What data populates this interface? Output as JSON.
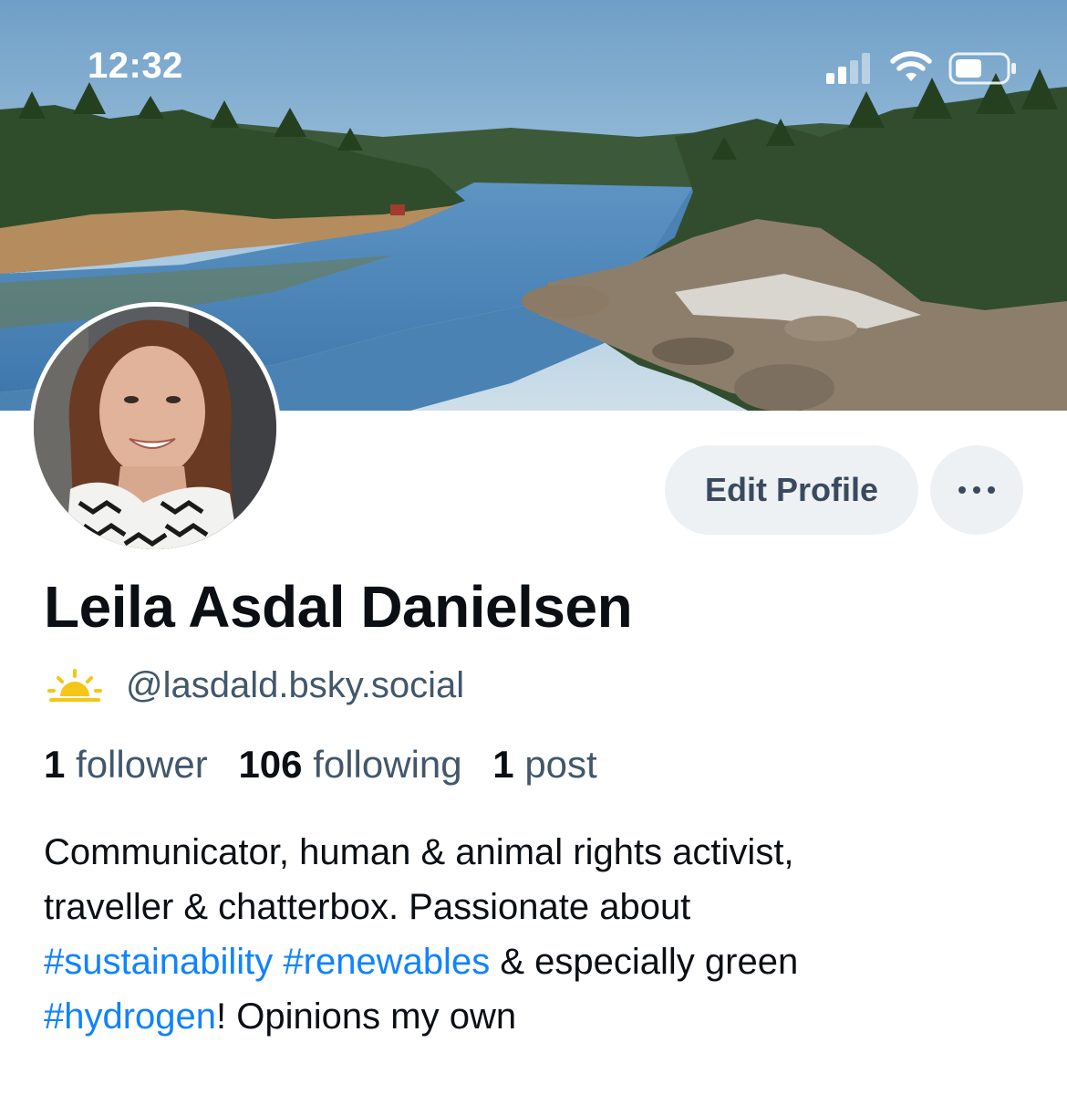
{
  "status_bar": {
    "time": "12:32"
  },
  "profile": {
    "display_name": "Leila Asdal Danielsen",
    "handle": "@lasdald.bsky.social",
    "handle_icon": "sunrise-icon",
    "edit_button": "Edit Profile",
    "more_icon": "ellipsis-icon"
  },
  "stats": {
    "followers_count": "1",
    "followers_label": "follower",
    "following_count": "106",
    "following_label": "following",
    "posts_count": "1",
    "posts_label": "post"
  },
  "bio": {
    "line1": "Communicator, human & animal rights activist,",
    "line2": "traveller & chatterbox. Passionate about",
    "tag_sustainability": "#sustainability",
    "tag_renewables": "#renewables",
    "text_especially": "& especially green",
    "tag_hydrogen": "#hydrogen",
    "text_end": "! Opinions my own"
  },
  "colors": {
    "link": "#1083fe",
    "secondary_text": "#42576c",
    "button_bg": "#eef1f4",
    "sunrise": "#f5c518"
  }
}
